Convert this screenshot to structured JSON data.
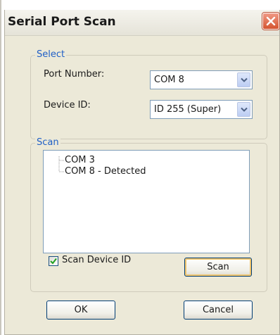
{
  "window": {
    "title": "Serial Port Scan"
  },
  "select_group": {
    "legend": "Select",
    "port_number_label": "Port Number:",
    "port_number_value": "COM 8",
    "device_id_label": "Device ID:",
    "device_id_value": "ID 255 (Super)"
  },
  "scan_group": {
    "legend": "Scan",
    "ports": [
      "COM 3",
      "COM 8 - Detected"
    ],
    "scan_device_id_label": "Scan Device ID",
    "scan_device_id_checked": true,
    "scan_button_label": "Scan"
  },
  "footer": {
    "ok_label": "OK",
    "cancel_label": "Cancel"
  },
  "icons": {
    "close": "close-icon",
    "dropdown": "chevron-down-icon",
    "check": "checkmark-icon"
  },
  "colors": {
    "dialog_background": "#ece9d8",
    "legend_text": "#1f5fc6",
    "close_button": "#d4532f",
    "check_mark": "#21a121",
    "default_button_highlight": "#f2c66d"
  }
}
